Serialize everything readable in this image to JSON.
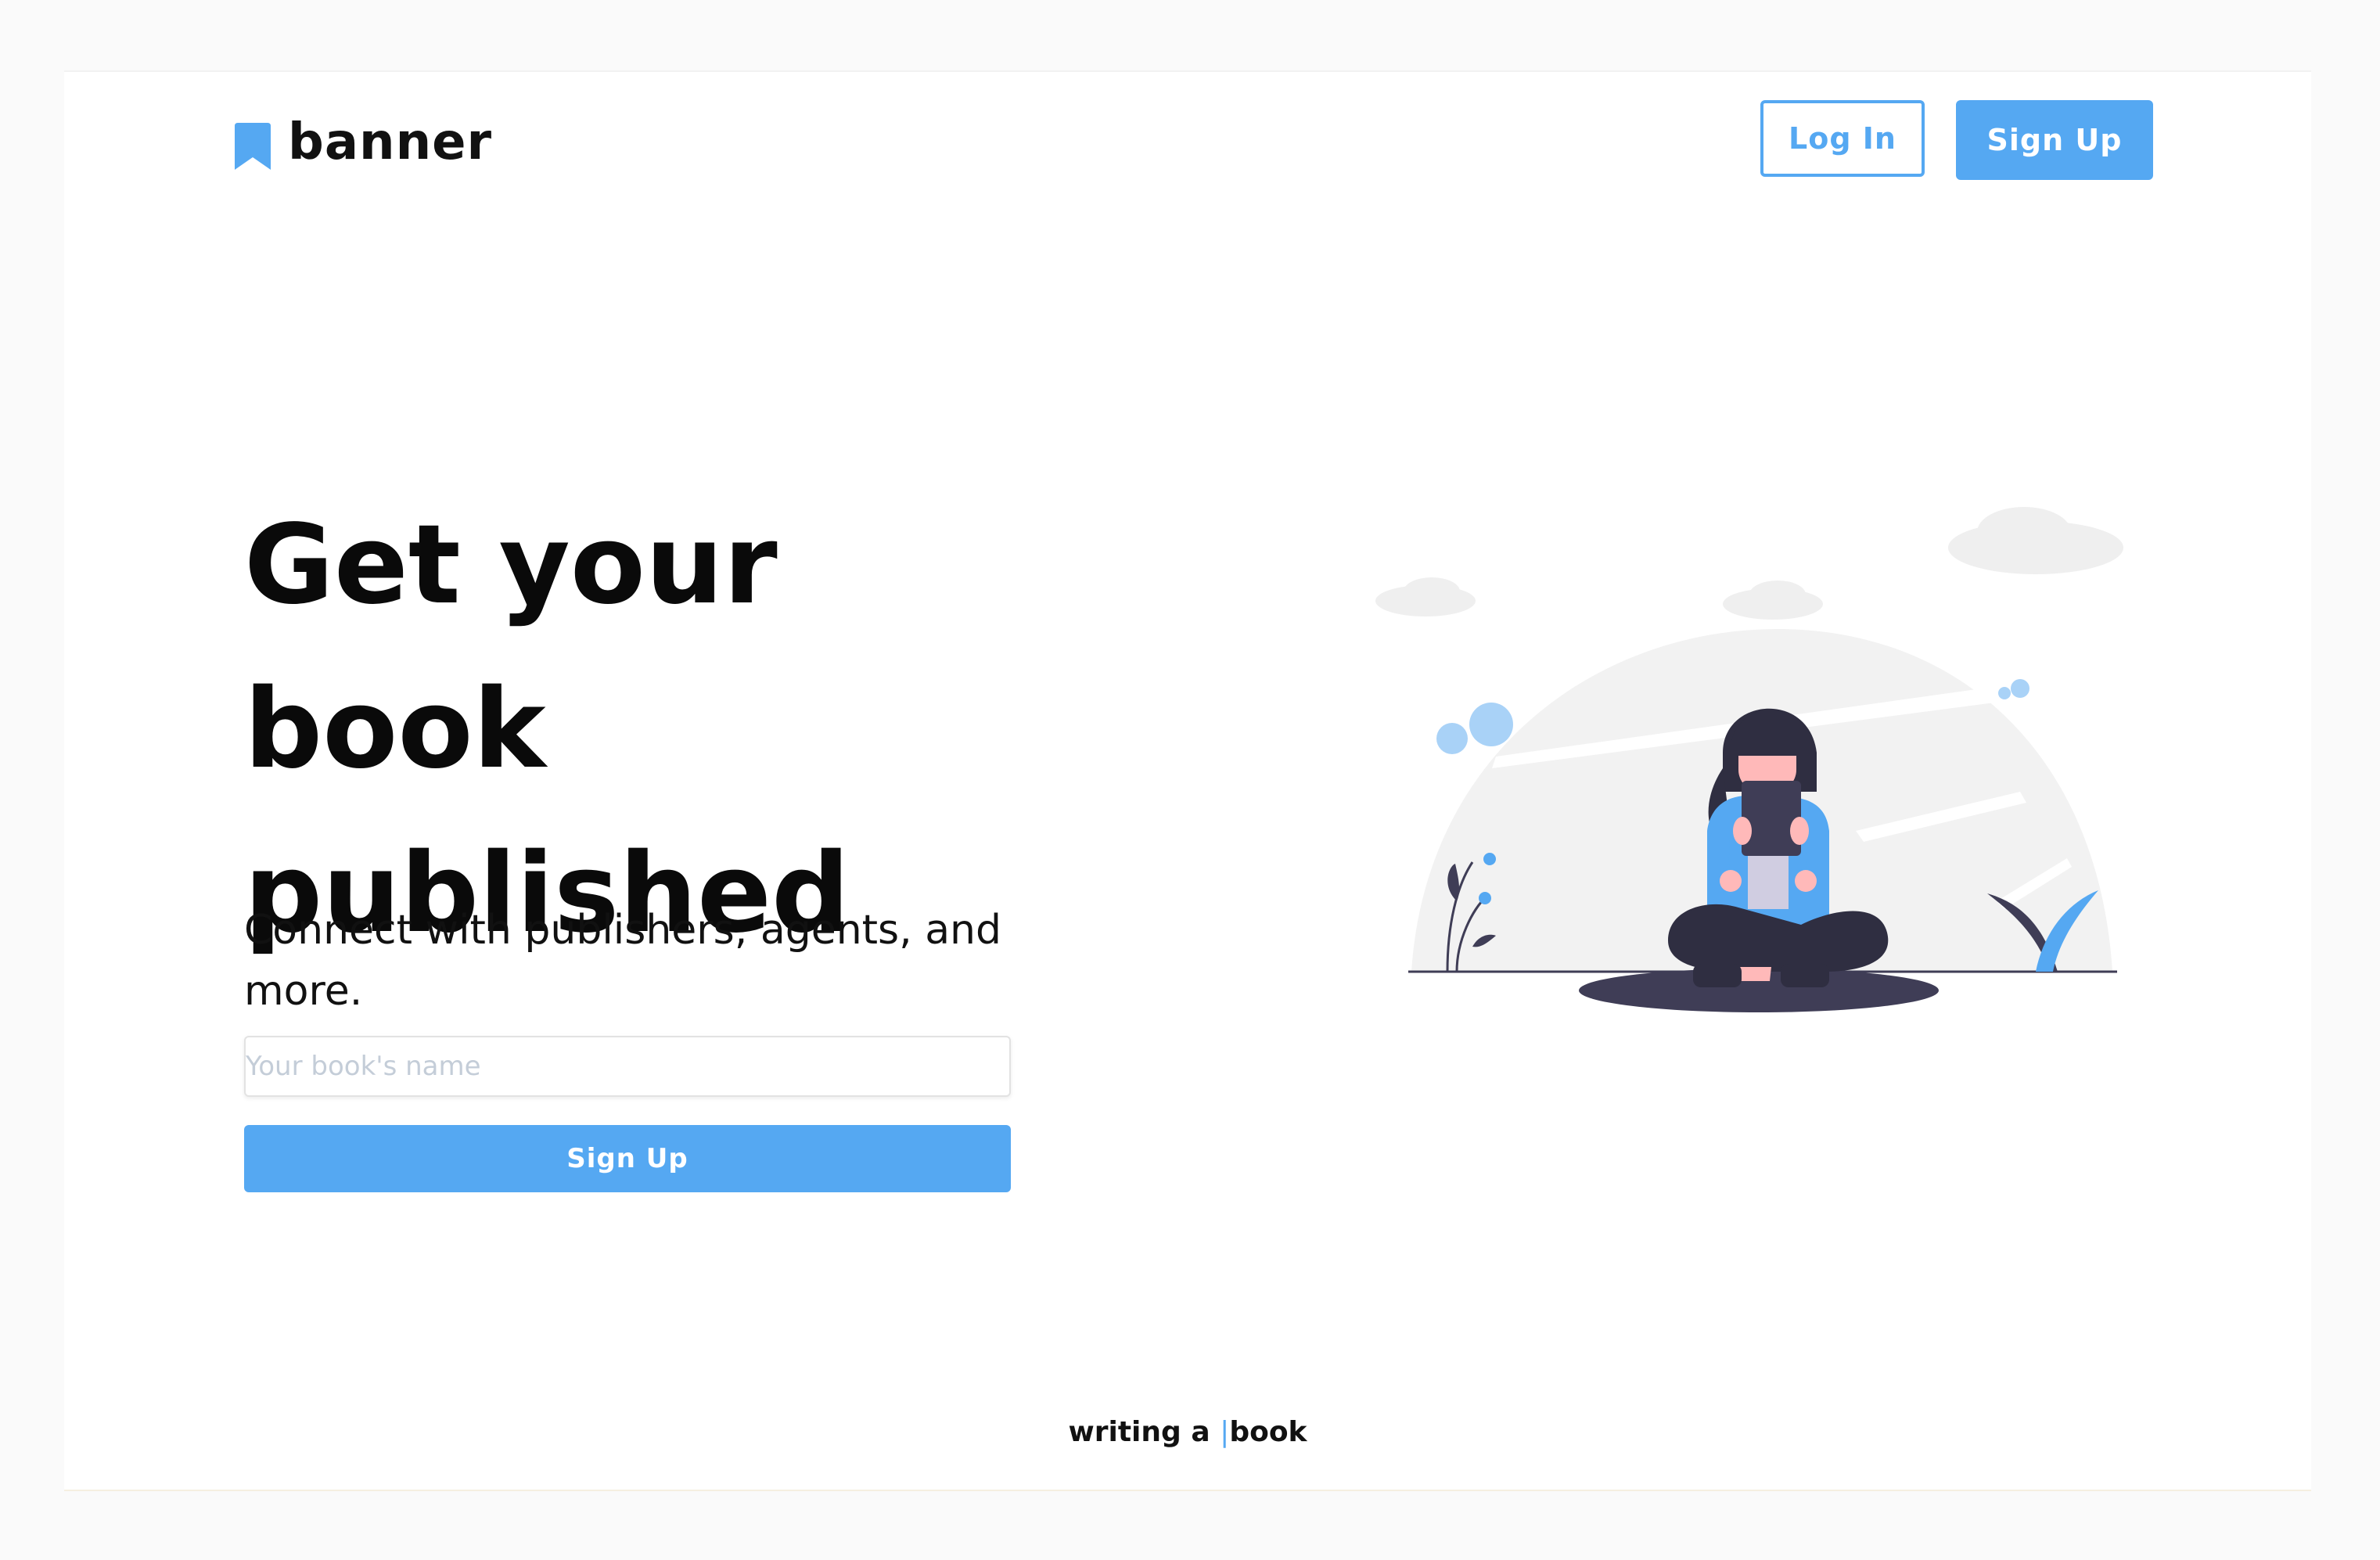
{
  "brand": {
    "name": "banner",
    "logo_icon": "bookmark-icon",
    "accent_color": "#55a8f2"
  },
  "nav": {
    "login_label": "Log In",
    "signup_label": "Sign Up"
  },
  "hero": {
    "headline_lines": [
      "Get your",
      "book",
      "published"
    ],
    "subtitle": "Connect with publishers, agents, and more.",
    "input_placeholder": "Your book's name",
    "input_value": "",
    "cta_label": "Sign Up",
    "illustration": "woman-reading-tablet-illustration"
  },
  "footer": {
    "typing_prefix": "writing a ",
    "typing_cursor": "|",
    "typing_word": "book"
  }
}
